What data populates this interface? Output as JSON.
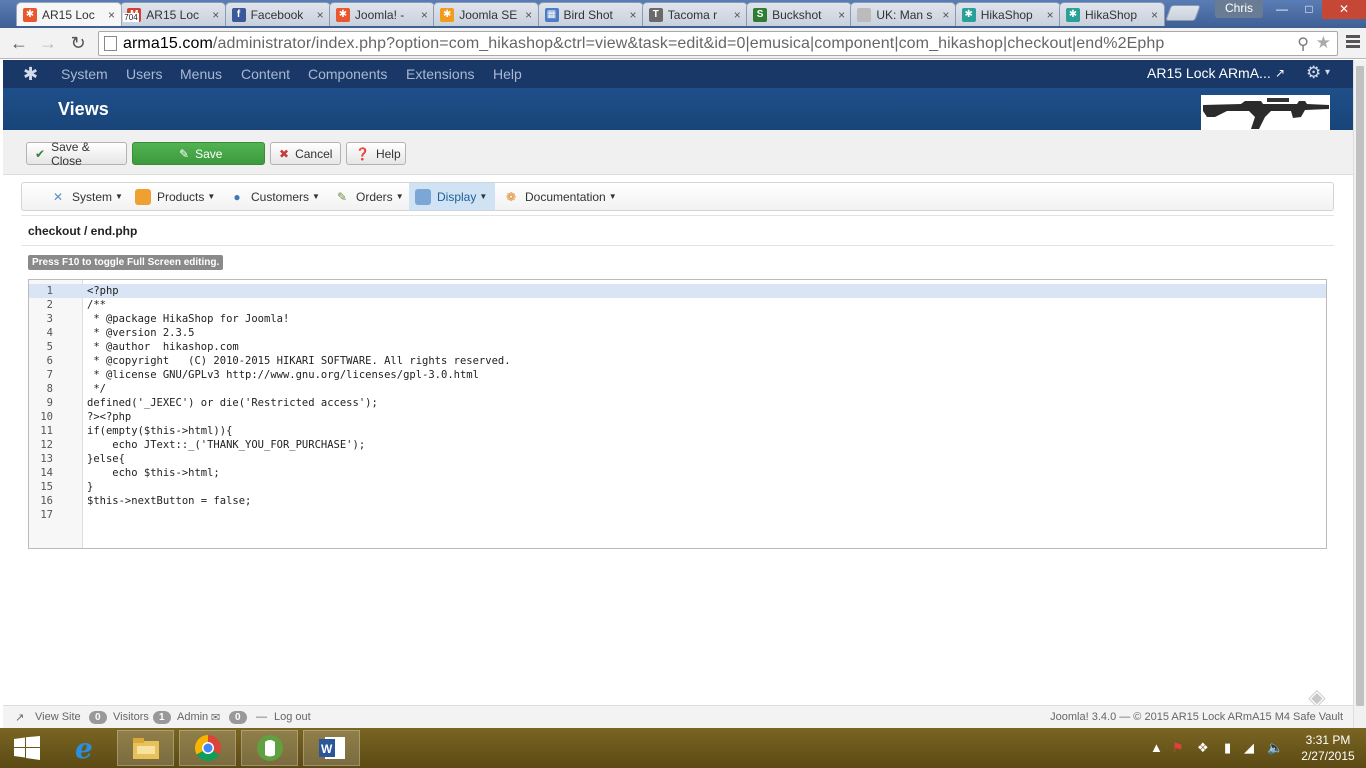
{
  "browser": {
    "tabs": [
      {
        "label": "AR15 Loc",
        "icon": "joomla-icon",
        "active": true
      },
      {
        "label": "AR15 Loc",
        "icon": "gmail-icon",
        "badge": "704"
      },
      {
        "label": "Facebook",
        "icon": "facebook-icon"
      },
      {
        "label": "Joomla! -",
        "icon": "joomla-icon"
      },
      {
        "label": "Joomla SE",
        "icon": "joomla-seo-icon"
      },
      {
        "label": "Bird Shot",
        "icon": "grid-icon"
      },
      {
        "label": "Tacoma r",
        "icon": "tacoma-icon"
      },
      {
        "label": "Buckshot",
        "icon": "s-icon"
      },
      {
        "label": "UK: Man s",
        "icon": "page-icon"
      },
      {
        "label": "HikaShop",
        "icon": "hikashop-icon"
      },
      {
        "label": "HikaShop",
        "icon": "hikashop-icon"
      }
    ],
    "user": "Chris",
    "url_domain": "arma15.com",
    "url_rest": "/administrator/index.php?option=com_hikashop&ctrl=view&task=edit&id=0|emusica|component|com_hikashop|checkout|end%2Ephp"
  },
  "admin_nav": {
    "items": [
      "System",
      "Users",
      "Menus",
      "Content",
      "Components",
      "Extensions",
      "Help"
    ],
    "site_name": "AR15 Lock ARmA..."
  },
  "header": {
    "title": "Views"
  },
  "toolbar": {
    "save_close": "Save & Close",
    "save": "Save",
    "cancel": "Cancel",
    "help": "Help"
  },
  "hika_menu": {
    "items": [
      {
        "label": "System",
        "icon": "tools-icon"
      },
      {
        "label": "Products",
        "icon": "products-icon"
      },
      {
        "label": "Customers",
        "icon": "customers-icon"
      },
      {
        "label": "Orders",
        "icon": "orders-icon"
      },
      {
        "label": "Display",
        "icon": "display-icon",
        "active": true
      },
      {
        "label": "Documentation",
        "icon": "documentation-icon"
      }
    ]
  },
  "view": {
    "path": "checkout / end.php",
    "fullscreen_hint": "Press F10 to toggle Full Screen editing."
  },
  "editor": {
    "lines": [
      "<?php",
      "/**",
      " * @package HikaShop for Joomla!",
      " * @version 2.3.5",
      " * @author  hikashop.com",
      " * @copyright   (C) 2010-2015 HIKARI SOFTWARE. All rights reserved.",
      " * @license GNU/GPLv3 http://www.gnu.org/licenses/gpl-3.0.html",
      " */",
      "defined('_JEXEC') or die('Restricted access');",
      "?><?php",
      "if(empty($this->html)){",
      "    echo JText::_('THANK_YOU_FOR_PURCHASE');",
      "}else{",
      "    echo $this->html;",
      "}",
      "$this->nextButton = false;",
      ""
    ],
    "active_line": 1
  },
  "status": {
    "view_site": "View Site",
    "visitors_count": "0",
    "visitors": "Visitors",
    "admin_count": "1",
    "admin": "Admin",
    "messages_count": "0",
    "logout": "Log out",
    "copyright": "Joomla! 3.4.0  —  © 2015 AR15 Lock ARmA15 M4 Safe Vault"
  },
  "taskbar": {
    "apps": [
      "file-explorer-icon",
      "chrome-icon",
      "evernote-icon",
      "word-icon"
    ],
    "time": "3:31 PM",
    "date": "2/27/2015"
  }
}
